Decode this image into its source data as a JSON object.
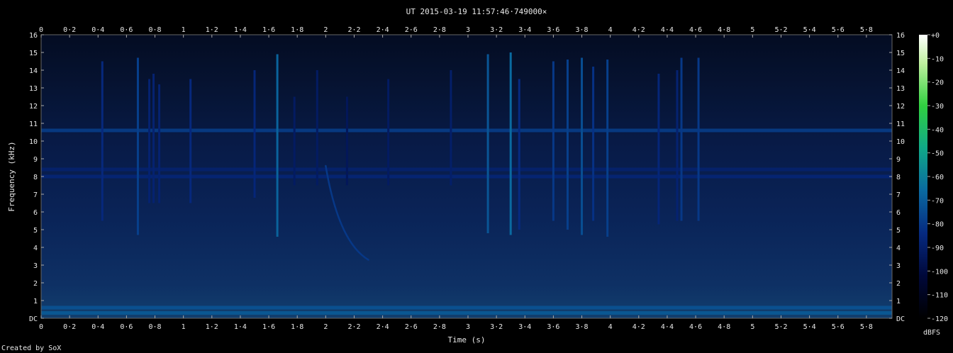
{
  "chart_data": {
    "type": "heatmap",
    "title": "UT 2015-03-19 11:57:46·749000×",
    "xlabel": "Time (s)",
    "ylabel": "Frequency (kHz)",
    "xlim": [
      0,
      5.98
    ],
    "ylim": [
      0,
      16
    ],
    "x_ticks": [
      "0",
      "0·2",
      "0·4",
      "0·6",
      "0·8",
      "1",
      "1·2",
      "1·4",
      "1·6",
      "1·8",
      "2",
      "2·2",
      "2·4",
      "2·6",
      "2·8",
      "3",
      "3·2",
      "3·4",
      "3·6",
      "3·8",
      "4",
      "4·2",
      "4·4",
      "4·6",
      "4·8",
      "5",
      "5·2",
      "5·4",
      "5·6",
      "5·8"
    ],
    "x_tick_values": [
      0,
      0.2,
      0.4,
      0.6,
      0.8,
      1,
      1.2,
      1.4,
      1.6,
      1.8,
      2,
      2.2,
      2.4,
      2.6,
      2.8,
      3,
      3.2,
      3.4,
      3.6,
      3.8,
      4,
      4.2,
      4.4,
      4.6,
      4.8,
      5,
      5.2,
      5.4,
      5.6,
      5.8
    ],
    "y_ticks": [
      "DC",
      "1",
      "2",
      "3",
      "4",
      "5",
      "6",
      "7",
      "8",
      "9",
      "10",
      "11",
      "12",
      "13",
      "14",
      "15",
      "16"
    ],
    "y_tick_values": [
      0,
      1,
      2,
      3,
      4,
      5,
      6,
      7,
      8,
      9,
      10,
      11,
      12,
      13,
      14,
      15,
      16
    ],
    "colorbar": {
      "label": "dBFS",
      "ticks": [
        "+0",
        "-10",
        "-20",
        "-30",
        "-40",
        "-50",
        "-60",
        "-70",
        "-80",
        "-90",
        "-100",
        "-110",
        "-120"
      ],
      "tick_values": [
        0,
        -10,
        -20,
        -30,
        -40,
        -50,
        -60,
        -70,
        -80,
        -90,
        -100,
        -110,
        -120
      ],
      "range": [
        -120,
        0
      ]
    },
    "horizontal_bands_khz": [
      {
        "f": 10.6,
        "level_dbfs": -78
      },
      {
        "f": 8.4,
        "level_dbfs": -88
      },
      {
        "f": 8.0,
        "level_dbfs": -86
      },
      {
        "f": 0.6,
        "level_dbfs": -72
      },
      {
        "f": 0.3,
        "level_dbfs": -70
      }
    ],
    "vertical_clicks": [
      {
        "t": 0.43,
        "fmin": 5.5,
        "fmax": 14.5,
        "level_dbfs": -85
      },
      {
        "t": 0.68,
        "fmin": 4.7,
        "fmax": 14.7,
        "level_dbfs": -78
      },
      {
        "t": 0.76,
        "fmin": 6.5,
        "fmax": 13.5,
        "level_dbfs": -88
      },
      {
        "t": 0.79,
        "fmin": 6.5,
        "fmax": 13.8,
        "level_dbfs": -88
      },
      {
        "t": 0.83,
        "fmin": 6.5,
        "fmax": 13.2,
        "level_dbfs": -88
      },
      {
        "t": 1.05,
        "fmin": 6.5,
        "fmax": 13.5,
        "level_dbfs": -85
      },
      {
        "t": 1.5,
        "fmin": 6.8,
        "fmax": 14.0,
        "level_dbfs": -86
      },
      {
        "t": 1.66,
        "fmin": 4.6,
        "fmax": 14.9,
        "level_dbfs": -68
      },
      {
        "t": 1.78,
        "fmin": 7.5,
        "fmax": 12.5,
        "level_dbfs": -92
      },
      {
        "t": 1.94,
        "fmin": 7.5,
        "fmax": 14.0,
        "level_dbfs": -92
      },
      {
        "t": 2.15,
        "fmin": 7.5,
        "fmax": 12.5,
        "level_dbfs": -94
      },
      {
        "t": 2.44,
        "fmin": 7.5,
        "fmax": 13.5,
        "level_dbfs": -92
      },
      {
        "t": 2.88,
        "fmin": 7.5,
        "fmax": 14.0,
        "level_dbfs": -90
      },
      {
        "t": 3.14,
        "fmin": 4.8,
        "fmax": 14.9,
        "level_dbfs": -72
      },
      {
        "t": 3.3,
        "fmin": 4.7,
        "fmax": 15.0,
        "level_dbfs": -66
      },
      {
        "t": 3.36,
        "fmin": 5.0,
        "fmax": 13.5,
        "level_dbfs": -84
      },
      {
        "t": 3.6,
        "fmin": 5.5,
        "fmax": 14.5,
        "level_dbfs": -80
      },
      {
        "t": 3.7,
        "fmin": 5.0,
        "fmax": 14.6,
        "level_dbfs": -78
      },
      {
        "t": 3.8,
        "fmin": 4.7,
        "fmax": 14.7,
        "level_dbfs": -74
      },
      {
        "t": 3.88,
        "fmin": 5.5,
        "fmax": 14.2,
        "level_dbfs": -82
      },
      {
        "t": 3.98,
        "fmin": 4.6,
        "fmax": 14.6,
        "level_dbfs": -78
      },
      {
        "t": 4.34,
        "fmin": 5.3,
        "fmax": 13.8,
        "level_dbfs": -86
      },
      {
        "t": 4.47,
        "fmin": 5.5,
        "fmax": 14.0,
        "level_dbfs": -88
      },
      {
        "t": 4.5,
        "fmin": 5.5,
        "fmax": 14.7,
        "level_dbfs": -80
      },
      {
        "t": 4.62,
        "fmin": 5.5,
        "fmax": 14.7,
        "level_dbfs": -80
      }
    ],
    "chirp": {
      "t_start": 2.0,
      "f_start": 8.6,
      "t_end": 2.3,
      "f_end": 3.3,
      "level_dbfs": -80
    }
  },
  "footer": {
    "credit": "Created by SoX"
  },
  "colors": {
    "background": "#000000",
    "text": "#e8e8e8"
  }
}
